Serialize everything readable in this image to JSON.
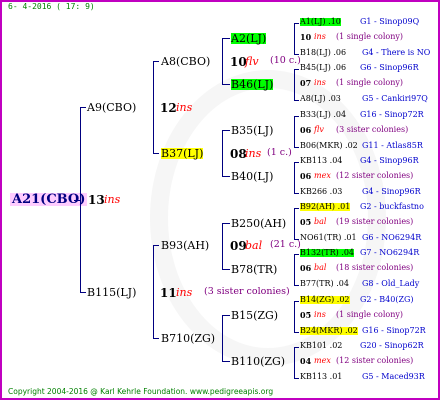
{
  "header": "6- 4-2016 ( 17: 9)",
  "footer": "Copyright 2004-2016 @ Karl Kehrle Foundation. www.pedigreeapis.org",
  "root": {
    "name": "A21(CBO)",
    "num": "13",
    "ins": "ins"
  },
  "gen1": [
    {
      "name": "A9(CBO)",
      "num": "12",
      "ins": "ins"
    },
    {
      "name": "B115(LJ)",
      "num": "11",
      "ins": "ins",
      "note": "(3 sister colonies)"
    }
  ],
  "gen2": [
    {
      "name": "A8(CBO)",
      "num": "10",
      "ins": "flv",
      "note": "(10 c.)"
    },
    {
      "name": "B37(LJ)",
      "num": "08",
      "ins": "ins",
      "note": "(1 c.)"
    },
    {
      "name": "B93(AH)",
      "num": "09",
      "ins": "bal",
      "note": "(21 c.)"
    },
    {
      "name": "B710(ZG)",
      "num": "",
      "ins": "",
      "note": ""
    }
  ],
  "gen3": [
    {
      "name": "A2(LJ)"
    },
    {
      "name": "B46(LJ)"
    },
    {
      "name": "B35(LJ)"
    },
    {
      "name": "B40(LJ)"
    },
    {
      "name": "B250(AH)"
    },
    {
      "name": "B78(TR)"
    },
    {
      "name": "B15(ZG)"
    },
    {
      "name": "B110(ZG)"
    }
  ],
  "gen4": [
    {
      "l1": "A1(LJ) .10",
      "l1c": "G1 - Sinop09Q",
      "n": "10",
      "i": "ins",
      "nt": "(1 single colony)",
      "l3": "B18(LJ) .06",
      "l3c": "G4 - There is NO"
    },
    {
      "l1": "B45(LJ) .06",
      "l1c": "G6 - Sinop96R",
      "n": "07",
      "i": "ins",
      "nt": "(1 single colony)",
      "l3": "A8(LJ) .03",
      "l3c": "G5 - Cankiri97Q"
    },
    {
      "l1": "B33(LJ) .04",
      "l1c": "G16 - Sinop72R",
      "n": "06",
      "i": "flv",
      "nt": "(3 sister colonies)",
      "l3": "B06(MKR) .02",
      "l3c": "G11 - Atlas85R"
    },
    {
      "l1": "KB113 .04",
      "l1c": "G4 - Sinop96R",
      "n": "06",
      "i": "mex",
      "nt": "(12 sister colonies)",
      "l3": "KB266 .03",
      "l3c": "G4 - Sinop96R"
    },
    {
      "l1": "B92(AH) .01",
      "l1c": "G2 - buckfastno",
      "n": "05",
      "i": "bal",
      "nt": "(19 sister colonies)",
      "l3": "NO61(TR) .01",
      "l3c": "G6 - NO6294R"
    },
    {
      "l1": "B132(TR) .04",
      "l1c": "G7 - NO6294R",
      "n": "06",
      "i": "bal",
      "nt": "(18 sister colonies)",
      "l3": "B77(TR) .04",
      "l3c": "G8 - Old_Lady"
    },
    {
      "l1": "B14(ZG) .02",
      "l1c": "G2 - B40(ZG)",
      "n": "05",
      "i": "ins",
      "nt": "(1 single colony)",
      "l3": "B24(MKR) .02",
      "l3c": "G16 - Sinop72R"
    },
    {
      "l1": "KB101 .02",
      "l1c": "G20 - Sinop62R",
      "n": "04",
      "i": "mex",
      "nt": "(12 sister colonies)",
      "l3": "KB113 .01",
      "l3c": "G5 - Maced93R"
    }
  ]
}
